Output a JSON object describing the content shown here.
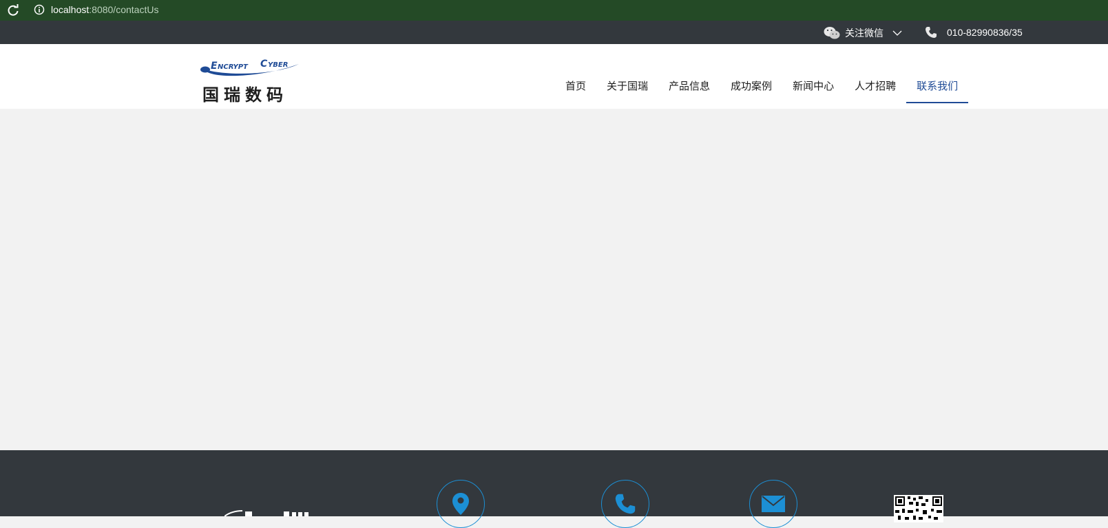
{
  "browser": {
    "host": "localhost",
    "path": ":8080/contactUs"
  },
  "topbar": {
    "wechat_label": "关注微信",
    "phone": "010-82990836/35"
  },
  "logo": {
    "text_en": "ENCRYPTCYBER",
    "text_cn": "国瑞数码"
  },
  "nav": {
    "items": [
      {
        "label": "首页"
      },
      {
        "label": "关于国瑞"
      },
      {
        "label": "产品信息"
      },
      {
        "label": "成功案例"
      },
      {
        "label": "新闻中心"
      },
      {
        "label": "人才招聘"
      },
      {
        "label": "联系我们",
        "active": true
      }
    ]
  },
  "colors": {
    "accent": "#1f4b96",
    "topbar": "#33383d",
    "icon_blue": "#1c8fd4"
  }
}
